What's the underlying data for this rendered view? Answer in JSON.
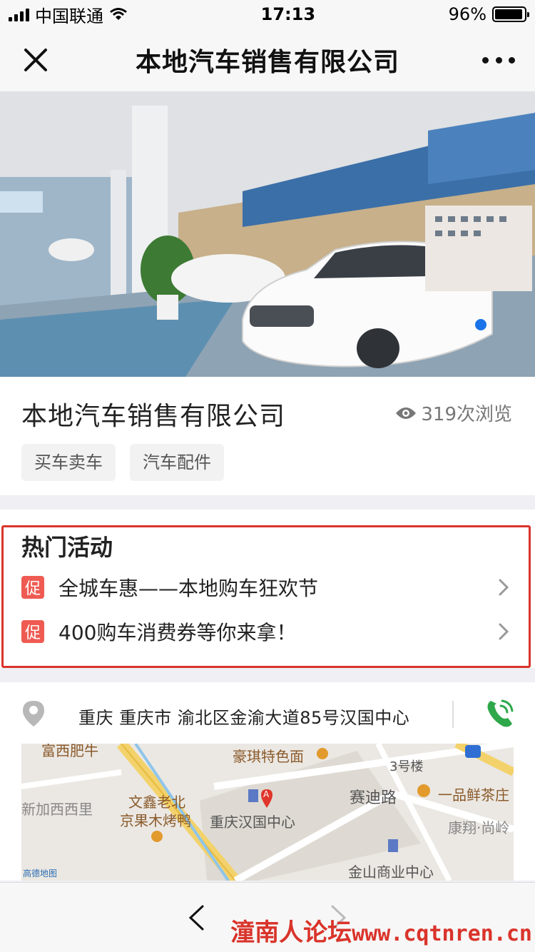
{
  "status_bar": {
    "carrier": "中国联通",
    "time": "17:13",
    "battery": "96%",
    "battery_level": 0.96
  },
  "nav": {
    "title": "本地汽车销售有限公司"
  },
  "hero": {
    "slide_count": 1,
    "active_slide": 1,
    "accent_color": "#1a73e8"
  },
  "store": {
    "name": "本地汽车销售有限公司",
    "views": "319次浏览",
    "tags": [
      "买车卖车",
      "汽车配件"
    ]
  },
  "hot": {
    "title": "热门活动",
    "badge": "促",
    "badge_color": "#ef5b52",
    "items": [
      "全城车惠——本地购车狂欢节",
      "400购车消费券等你来拿！"
    ]
  },
  "address": {
    "text": "重庆 重庆市 渝北区金渝大道85号汉国中心",
    "phone_color": "#2ea84a"
  },
  "map": {
    "labels": {
      "l1": "富西肥牛",
      "l2": "豪琪特色面",
      "l3": "3号楼",
      "l4": "赛迪路",
      "l5": "一品鲜茶庄",
      "l6": "新加西西里",
      "l7": "文鑫老北",
      "l8": "京果木烤鸭",
      "l9": "重庆汉国中心",
      "l10": "康翔·尚岭",
      "l11": "金山商业中心",
      "logo": "高德地图"
    },
    "marker": "A"
  },
  "watermark": {
    "cn": "潼南人论坛",
    "url": "www.cqtnren.cn"
  }
}
